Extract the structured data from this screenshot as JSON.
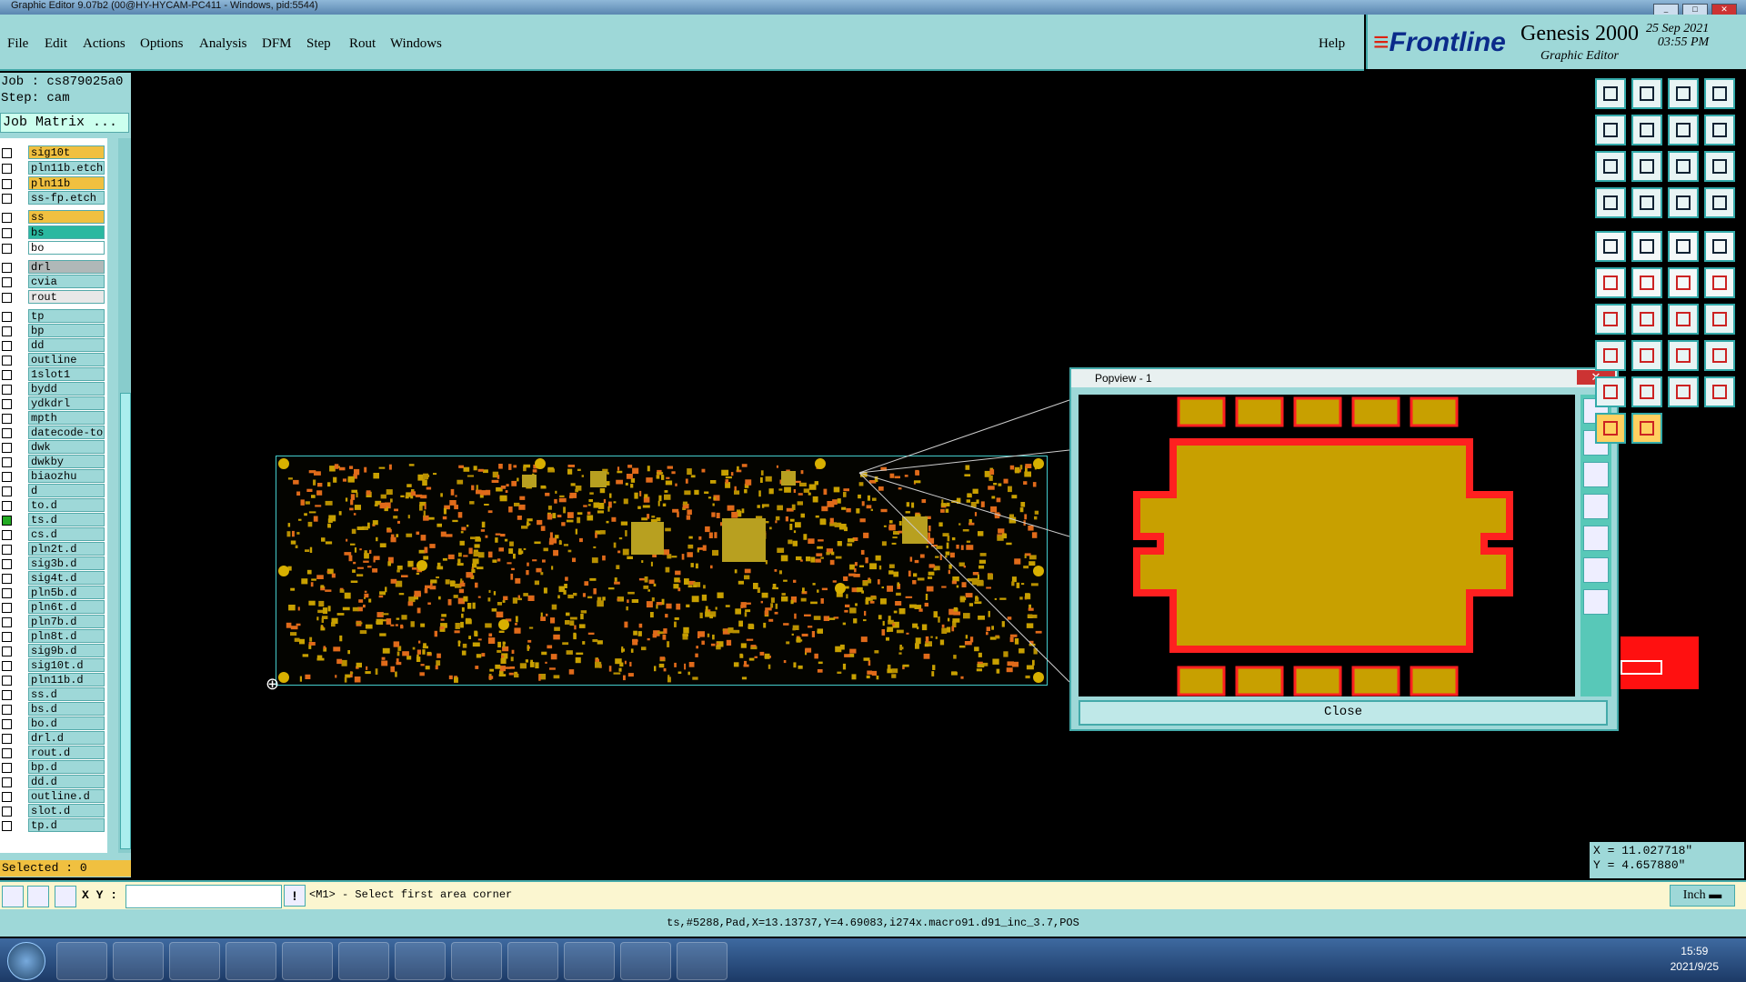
{
  "window": {
    "title": "Graphic Editor 9.07b2 (00@HY-HYCAM-PC411 - Windows, pid:5544)"
  },
  "menu": [
    "File",
    "Edit",
    "Actions",
    "Options",
    "Analysis",
    "DFM",
    "Step",
    "Rout",
    "Windows"
  ],
  "help_label": "Help",
  "logo": {
    "brand": "Frontline",
    "product": "Genesis 2000",
    "subtitle": "Graphic Editor",
    "date": "25 Sep 2021",
    "time": "03:55 PM"
  },
  "job": {
    "job_line": "Job : cs879025a0",
    "step_line": "Step: cam",
    "matrix_button": "Job Matrix ..."
  },
  "layers": [
    {
      "name": "sig10t",
      "color": "#f0c040"
    },
    {
      "name": "pln11b.etch",
      "color": "#9ed8d8"
    },
    {
      "name": "pln11b",
      "color": "#f0c040"
    },
    {
      "name": "ss-fp.etch",
      "color": "#9ed8d8"
    },
    {
      "name": "ss",
      "color": "#f0c040"
    },
    {
      "name": "bs",
      "color": "#2ab8a0"
    },
    {
      "name": "bo",
      "color": "#ffffff"
    },
    {
      "name": "drl",
      "color": "#b0b8b8"
    },
    {
      "name": "cvia",
      "color": "#9ed8d8"
    },
    {
      "name": "rout",
      "color": "#e8e8e8"
    },
    {
      "name": "tp",
      "color": "#9ed8d8"
    },
    {
      "name": "bp",
      "color": "#9ed8d8"
    },
    {
      "name": "dd",
      "color": "#9ed8d8"
    },
    {
      "name": "outline",
      "color": "#9ed8d8"
    },
    {
      "name": "1slot1",
      "color": "#9ed8d8"
    },
    {
      "name": "bydd",
      "color": "#9ed8d8"
    },
    {
      "name": "ydkdrl",
      "color": "#9ed8d8"
    },
    {
      "name": "mpth",
      "color": "#9ed8d8"
    },
    {
      "name": "datecode-to",
      "color": "#9ed8d8"
    },
    {
      "name": "dwk",
      "color": "#9ed8d8"
    },
    {
      "name": "dwkby",
      "color": "#9ed8d8"
    },
    {
      "name": "biaozhu",
      "color": "#9ed8d8"
    },
    {
      "name": "d",
      "color": "#9ed8d8"
    },
    {
      "name": "to.d",
      "color": "#9ed8d8"
    },
    {
      "name": "ts.d",
      "color": "#9ed8d8"
    },
    {
      "name": "cs.d",
      "color": "#9ed8d8"
    },
    {
      "name": "pln2t.d",
      "color": "#9ed8d8"
    },
    {
      "name": "sig3b.d",
      "color": "#9ed8d8"
    },
    {
      "name": "sig4t.d",
      "color": "#9ed8d8"
    },
    {
      "name": "pln5b.d",
      "color": "#9ed8d8"
    },
    {
      "name": "pln6t.d",
      "color": "#9ed8d8"
    },
    {
      "name": "pln7b.d",
      "color": "#9ed8d8"
    },
    {
      "name": "pln8t.d",
      "color": "#9ed8d8"
    },
    {
      "name": "sig9b.d",
      "color": "#9ed8d8"
    },
    {
      "name": "sig10t.d",
      "color": "#9ed8d8"
    },
    {
      "name": "pln11b.d",
      "color": "#9ed8d8"
    },
    {
      "name": "ss.d",
      "color": "#9ed8d8"
    },
    {
      "name": "bs.d",
      "color": "#9ed8d8"
    },
    {
      "name": "bo.d",
      "color": "#9ed8d8"
    },
    {
      "name": "drl.d",
      "color": "#9ed8d8"
    },
    {
      "name": "rout.d",
      "color": "#9ed8d8"
    },
    {
      "name": "bp.d",
      "color": "#9ed8d8"
    },
    {
      "name": "dd.d",
      "color": "#9ed8d8"
    },
    {
      "name": "outline.d",
      "color": "#9ed8d8"
    },
    {
      "name": "slot.d",
      "color": "#9ed8d8"
    },
    {
      "name": "tp.d",
      "color": "#9ed8d8"
    }
  ],
  "selected_label": "Selected : 0",
  "popview": {
    "title": "Popview - 1",
    "close_label": "Close"
  },
  "coords": {
    "x": "X = 11.027718\"",
    "y": "Y = 4.657880\""
  },
  "command": {
    "xy_label": "X Y :",
    "prompt": "<M1> - Select first area corner",
    "units": "Inch"
  },
  "status_text": "ts,#5288,Pad,X=13.13737,Y=4.69083,i274x.macro91.d91_inc_3.7,POS",
  "clock": {
    "time": "15:59",
    "date": "2021/9/25"
  },
  "colors": {
    "pad": "#c8a000",
    "pad_outline": "#ff2020",
    "panel": "#9ed8d8",
    "feature_orange": "#e06a1a"
  }
}
